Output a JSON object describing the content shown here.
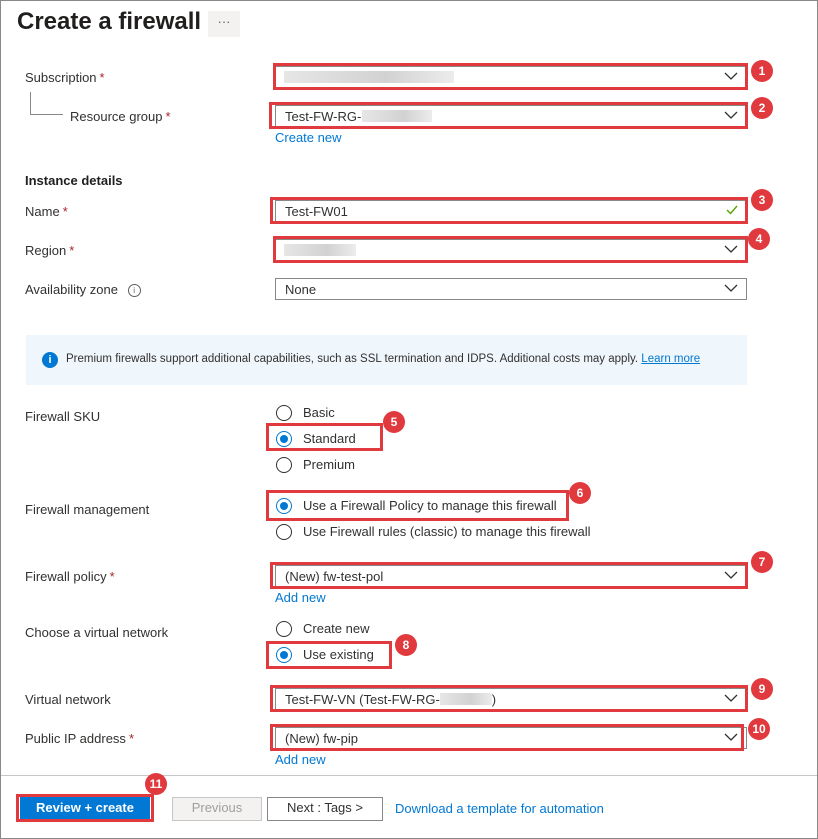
{
  "header": {
    "title": "Create a firewall",
    "more_label": "···"
  },
  "subscription": {
    "label": "Subscription",
    "required": "*",
    "value": ""
  },
  "resource_group": {
    "label": "Resource group",
    "required": "*",
    "value": "Test-FW-RG-",
    "create_link": "Create new"
  },
  "instance": {
    "section": "Instance details",
    "name": {
      "label": "Name",
      "required": "*",
      "value": "Test-FW01"
    },
    "region": {
      "label": "Region",
      "required": "*",
      "value": ""
    },
    "zone": {
      "label": "Availability zone",
      "info_icon": "i",
      "value": "None"
    }
  },
  "info_bar": {
    "icon": "i",
    "text": "Premium firewalls support additional capabilities, such as SSL termination and IDPS. Additional costs may apply.",
    "link": "Learn more"
  },
  "sku": {
    "label": "Firewall SKU",
    "options": [
      "Basic",
      "Standard",
      "Premium"
    ],
    "selected": "Standard"
  },
  "management": {
    "label": "Firewall management",
    "options": [
      "Use a Firewall Policy to manage this firewall",
      "Use Firewall rules (classic) to manage this firewall"
    ],
    "selected": "Use a Firewall Policy to manage this firewall"
  },
  "policy": {
    "label": "Firewall policy",
    "required": "*",
    "value": "(New) fw-test-pol",
    "add_link": "Add new"
  },
  "vnet_choice": {
    "label": "Choose a virtual network",
    "options": [
      "Create new",
      "Use existing"
    ],
    "selected": "Use existing"
  },
  "vnet": {
    "label": "Virtual network",
    "value_prefix": "Test-FW-VN (Test-FW-RG-",
    "value_suffix": ")"
  },
  "public_ip": {
    "label": "Public IP address",
    "required": "*",
    "value": "(New) fw-pip",
    "add_link": "Add new"
  },
  "footer": {
    "review_create": "Review + create",
    "previous": "Previous",
    "next": "Next : Tags >",
    "download": "Download a template for automation"
  },
  "callouts": [
    "1",
    "2",
    "3",
    "4",
    "5",
    "6",
    "7",
    "8",
    "9",
    "10",
    "11"
  ],
  "colors": {
    "accent": "#0078d4",
    "highlight": "#e0393e",
    "info_bg": "#eff6fc",
    "required": "#a4262c",
    "valid": "#57a300"
  },
  "icons": {
    "dropdown": "chevron-down-icon",
    "valid": "checkmark-icon",
    "info": "info-icon"
  }
}
